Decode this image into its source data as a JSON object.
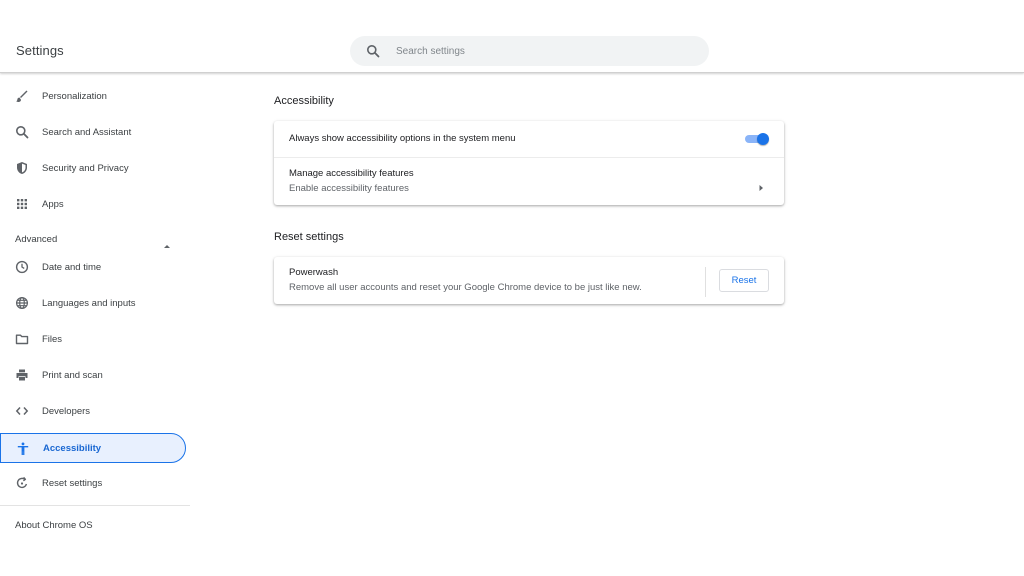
{
  "header": {
    "title": "Settings",
    "search_placeholder": "Search settings"
  },
  "window_controls": [
    "minimize-icon",
    "restore-icon",
    "close-icon"
  ],
  "sidebar": {
    "items": [
      {
        "label": "Personalization",
        "icon": "brush-icon"
      },
      {
        "label": "Search and Assistant",
        "icon": "search-icon"
      },
      {
        "label": "Security and Privacy",
        "icon": "shield-icon"
      },
      {
        "label": "Apps",
        "icon": "apps-grid-icon"
      }
    ],
    "advanced_label": "Advanced",
    "advanced_items": [
      {
        "label": "Date and time",
        "icon": "clock-icon"
      },
      {
        "label": "Languages and inputs",
        "icon": "globe-icon"
      },
      {
        "label": "Files",
        "icon": "folder-icon"
      },
      {
        "label": "Print and scan",
        "icon": "printer-icon"
      },
      {
        "label": "Developers",
        "icon": "code-icon"
      },
      {
        "label": "Accessibility",
        "icon": "accessibility-icon",
        "active": true
      },
      {
        "label": "Reset settings",
        "icon": "reset-icon"
      }
    ],
    "about_label": "About Chrome OS"
  },
  "main": {
    "accessibility": {
      "title": "Accessibility",
      "show_options_label": "Always show accessibility options in the system menu",
      "show_options_enabled": true,
      "manage_label": "Manage accessibility features",
      "manage_sublabel": "Enable accessibility features"
    },
    "reset": {
      "title": "Reset settings",
      "powerwash_label": "Powerwash",
      "powerwash_sublabel": "Remove all user accounts and reset your Google Chrome device to be just like new.",
      "reset_button": "Reset"
    }
  },
  "colors": {
    "accent": "#1a73e8",
    "active_bg": "#e8f0fe",
    "toggle_track": "#8ab4f8"
  }
}
